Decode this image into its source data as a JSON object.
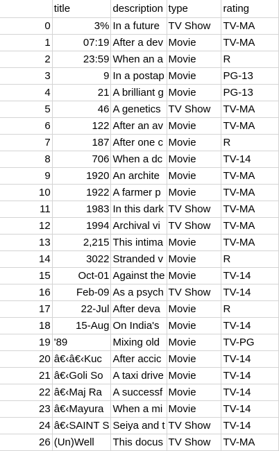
{
  "columns": {
    "index": "",
    "title": "title",
    "description": "description",
    "type": "type",
    "rating": "rating"
  },
  "rows": [
    {
      "index": "0",
      "title": "3%",
      "title_numeric": true,
      "description": "In a future",
      "type": "TV Show",
      "rating": "TV-MA"
    },
    {
      "index": "1",
      "title": "07:19",
      "title_numeric": true,
      "description": "After a dev",
      "type": "Movie",
      "rating": "TV-MA"
    },
    {
      "index": "2",
      "title": "23:59",
      "title_numeric": true,
      "description": "When an a",
      "type": "Movie",
      "rating": "R"
    },
    {
      "index": "3",
      "title": "9",
      "title_numeric": true,
      "description": "In a postap",
      "type": "Movie",
      "rating": "PG-13"
    },
    {
      "index": "4",
      "title": "21",
      "title_numeric": true,
      "description": "A brilliant g",
      "type": "Movie",
      "rating": "PG-13"
    },
    {
      "index": "5",
      "title": "46",
      "title_numeric": true,
      "description": "A genetics",
      "type": "TV Show",
      "rating": "TV-MA"
    },
    {
      "index": "6",
      "title": "122",
      "title_numeric": true,
      "description": "After an av",
      "type": "Movie",
      "rating": "TV-MA"
    },
    {
      "index": "7",
      "title": "187",
      "title_numeric": true,
      "description": "After one c",
      "type": "Movie",
      "rating": "R"
    },
    {
      "index": "8",
      "title": "706",
      "title_numeric": true,
      "description": "When a dc",
      "type": "Movie",
      "rating": "TV-14"
    },
    {
      "index": "9",
      "title": "1920",
      "title_numeric": true,
      "description": "An archite",
      "type": "Movie",
      "rating": "TV-MA"
    },
    {
      "index": "10",
      "title": "1922",
      "title_numeric": true,
      "description": "A farmer p",
      "type": "Movie",
      "rating": "TV-MA"
    },
    {
      "index": "11",
      "title": "1983",
      "title_numeric": true,
      "description": "In this dark",
      "type": "TV Show",
      "rating": "TV-MA"
    },
    {
      "index": "12",
      "title": "1994",
      "title_numeric": true,
      "description": "Archival vi",
      "type": "TV Show",
      "rating": "TV-MA"
    },
    {
      "index": "13",
      "title": "2,215",
      "title_numeric": true,
      "description": "This intima",
      "type": "Movie",
      "rating": "TV-MA"
    },
    {
      "index": "14",
      "title": "3022",
      "title_numeric": true,
      "description": "Stranded v",
      "type": "Movie",
      "rating": "R"
    },
    {
      "index": "15",
      "title": "Oct-01",
      "title_numeric": true,
      "description": "Against the",
      "type": "Movie",
      "rating": "TV-14"
    },
    {
      "index": "16",
      "title": "Feb-09",
      "title_numeric": true,
      "description": "As a psych",
      "type": "TV Show",
      "rating": "TV-14"
    },
    {
      "index": "17",
      "title": "22-Jul",
      "title_numeric": true,
      "description": "After deva",
      "type": "Movie",
      "rating": "R"
    },
    {
      "index": "18",
      "title": "15-Aug",
      "title_numeric": true,
      "description": "On India's",
      "type": "Movie",
      "rating": "TV-14"
    },
    {
      "index": "19",
      "title": "'89",
      "title_numeric": false,
      "description": "Mixing old",
      "type": "Movie",
      "rating": "TV-PG"
    },
    {
      "index": "20",
      "title": "â€‹â€‹Kuc",
      "title_numeric": false,
      "description": "After accic",
      "type": "Movie",
      "rating": "TV-14"
    },
    {
      "index": "21",
      "title": "â€‹Goli So",
      "title_numeric": false,
      "description": "A taxi drive",
      "type": "Movie",
      "rating": "TV-14"
    },
    {
      "index": "22",
      "title": "â€‹Maj Ra",
      "title_numeric": false,
      "description": "A successf",
      "type": "Movie",
      "rating": "TV-14"
    },
    {
      "index": "23",
      "title": "â€‹Mayura",
      "title_numeric": false,
      "description": "When a mi",
      "type": "Movie",
      "rating": "TV-14"
    },
    {
      "index": "24",
      "title": "â€‹SAINT S",
      "title_numeric": false,
      "description": "Seiya and t",
      "type": "TV Show",
      "rating": "TV-14"
    },
    {
      "index": "26",
      "title": "(Un)Well",
      "title_numeric": false,
      "description": "This docus",
      "type": "TV Show",
      "rating": "TV-MA"
    }
  ]
}
